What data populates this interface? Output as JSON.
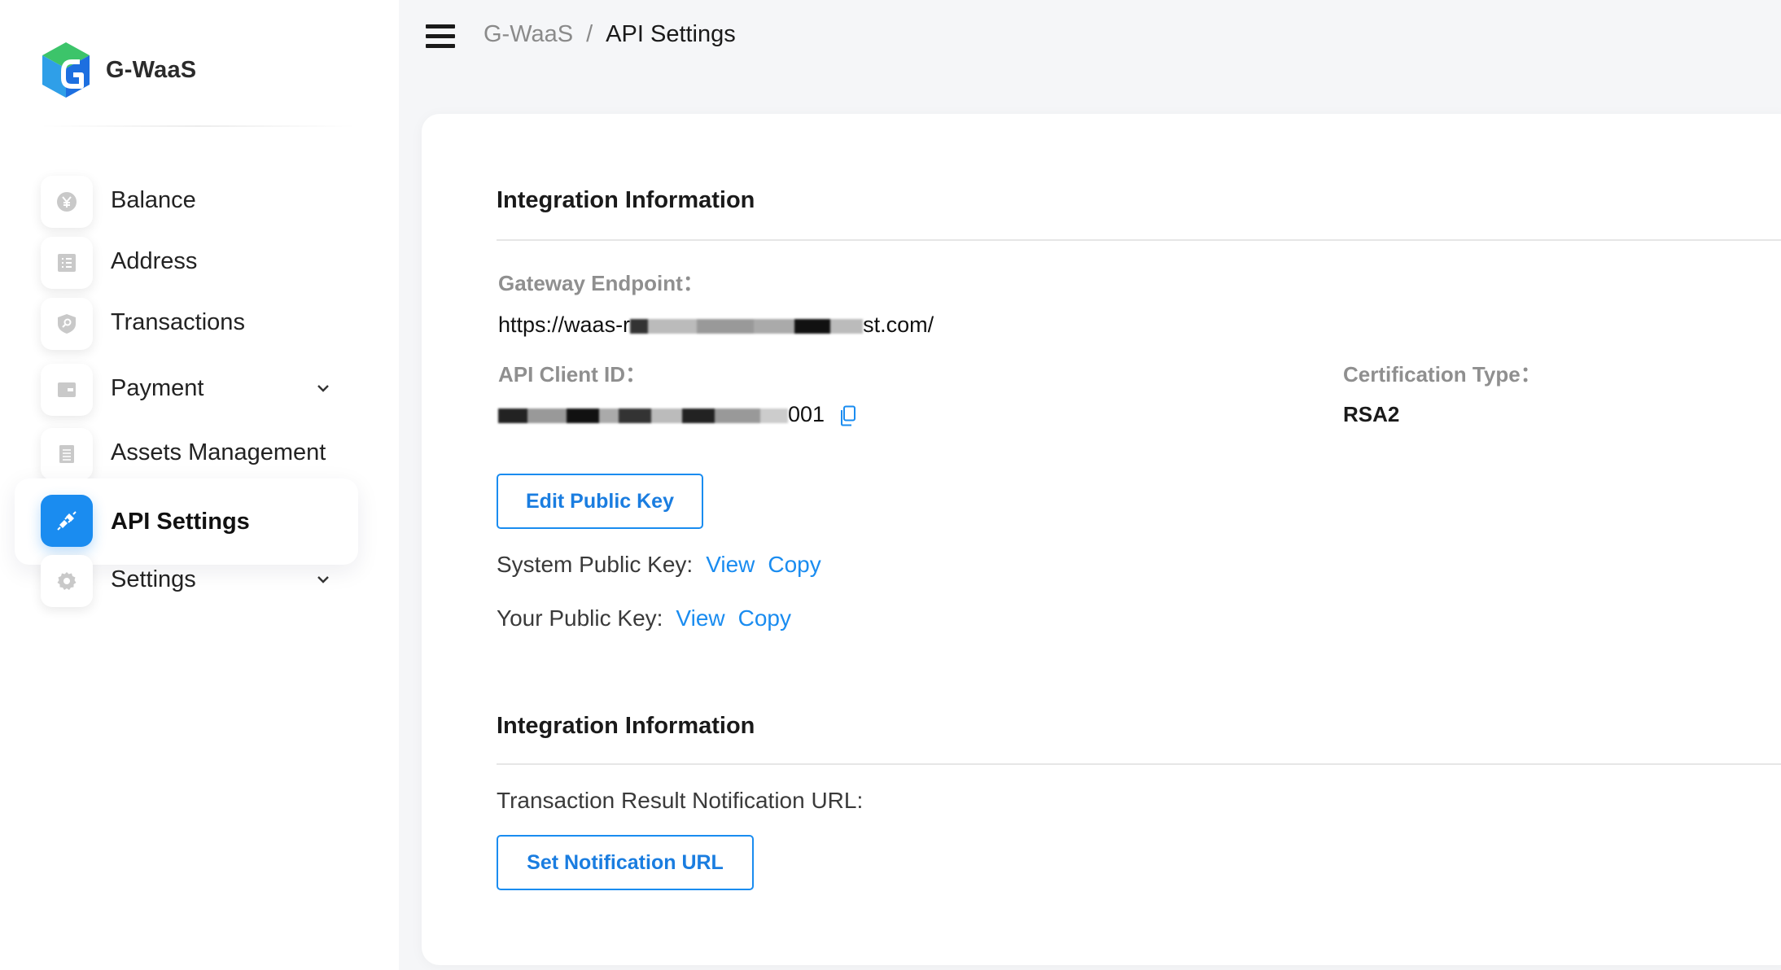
{
  "brand": {
    "name": "G-WaaS",
    "logo_icon": "g-cube-logo"
  },
  "sidebar": {
    "items": [
      {
        "label": "Balance",
        "icon": "yen-coin-icon",
        "active": false,
        "has_chevron": false
      },
      {
        "label": "Address",
        "icon": "list-card-icon",
        "active": false,
        "has_chevron": false
      },
      {
        "label": "Transactions",
        "icon": "shield-key-icon",
        "active": false,
        "has_chevron": false
      },
      {
        "label": "Payment",
        "icon": "wallet-card-icon",
        "active": false,
        "has_chevron": true
      },
      {
        "label": "Assets Management",
        "icon": "document-stack-icon",
        "active": false,
        "has_chevron": false
      },
      {
        "label": "API Settings",
        "icon": "plug-connector-icon",
        "active": true,
        "has_chevron": false
      },
      {
        "label": "Settings",
        "icon": "gear-icon",
        "active": false,
        "has_chevron": true
      }
    ]
  },
  "header": {
    "breadcrumb_root": "G-WaaS",
    "breadcrumb_sep": "/",
    "breadcrumb_current": "API Settings"
  },
  "integration": {
    "title": "Integration Information",
    "gateway_label": "Gateway Endpoint：",
    "gateway_value": "https://waas-r",
    "gateway_value_tail": "st.com/",
    "client_id_label": "API Client ID：",
    "client_id_value_tail": "001",
    "cert_label": "Certification Type：",
    "cert_value": "RSA2",
    "edit_key_button": "Edit Public Key",
    "system_key_label": "System Public Key:",
    "your_key_label": "Your Public Key:",
    "view_link": "View",
    "copy_link": "Copy"
  },
  "notification": {
    "title": "Integration Information",
    "url_label": "Transaction Result Notification URL:",
    "set_url_button": "Set Notification URL"
  },
  "colors": {
    "accent": "#1a8cf0",
    "active_nav_bg": "#1a8cf0",
    "text_muted": "#8f8f8f"
  }
}
